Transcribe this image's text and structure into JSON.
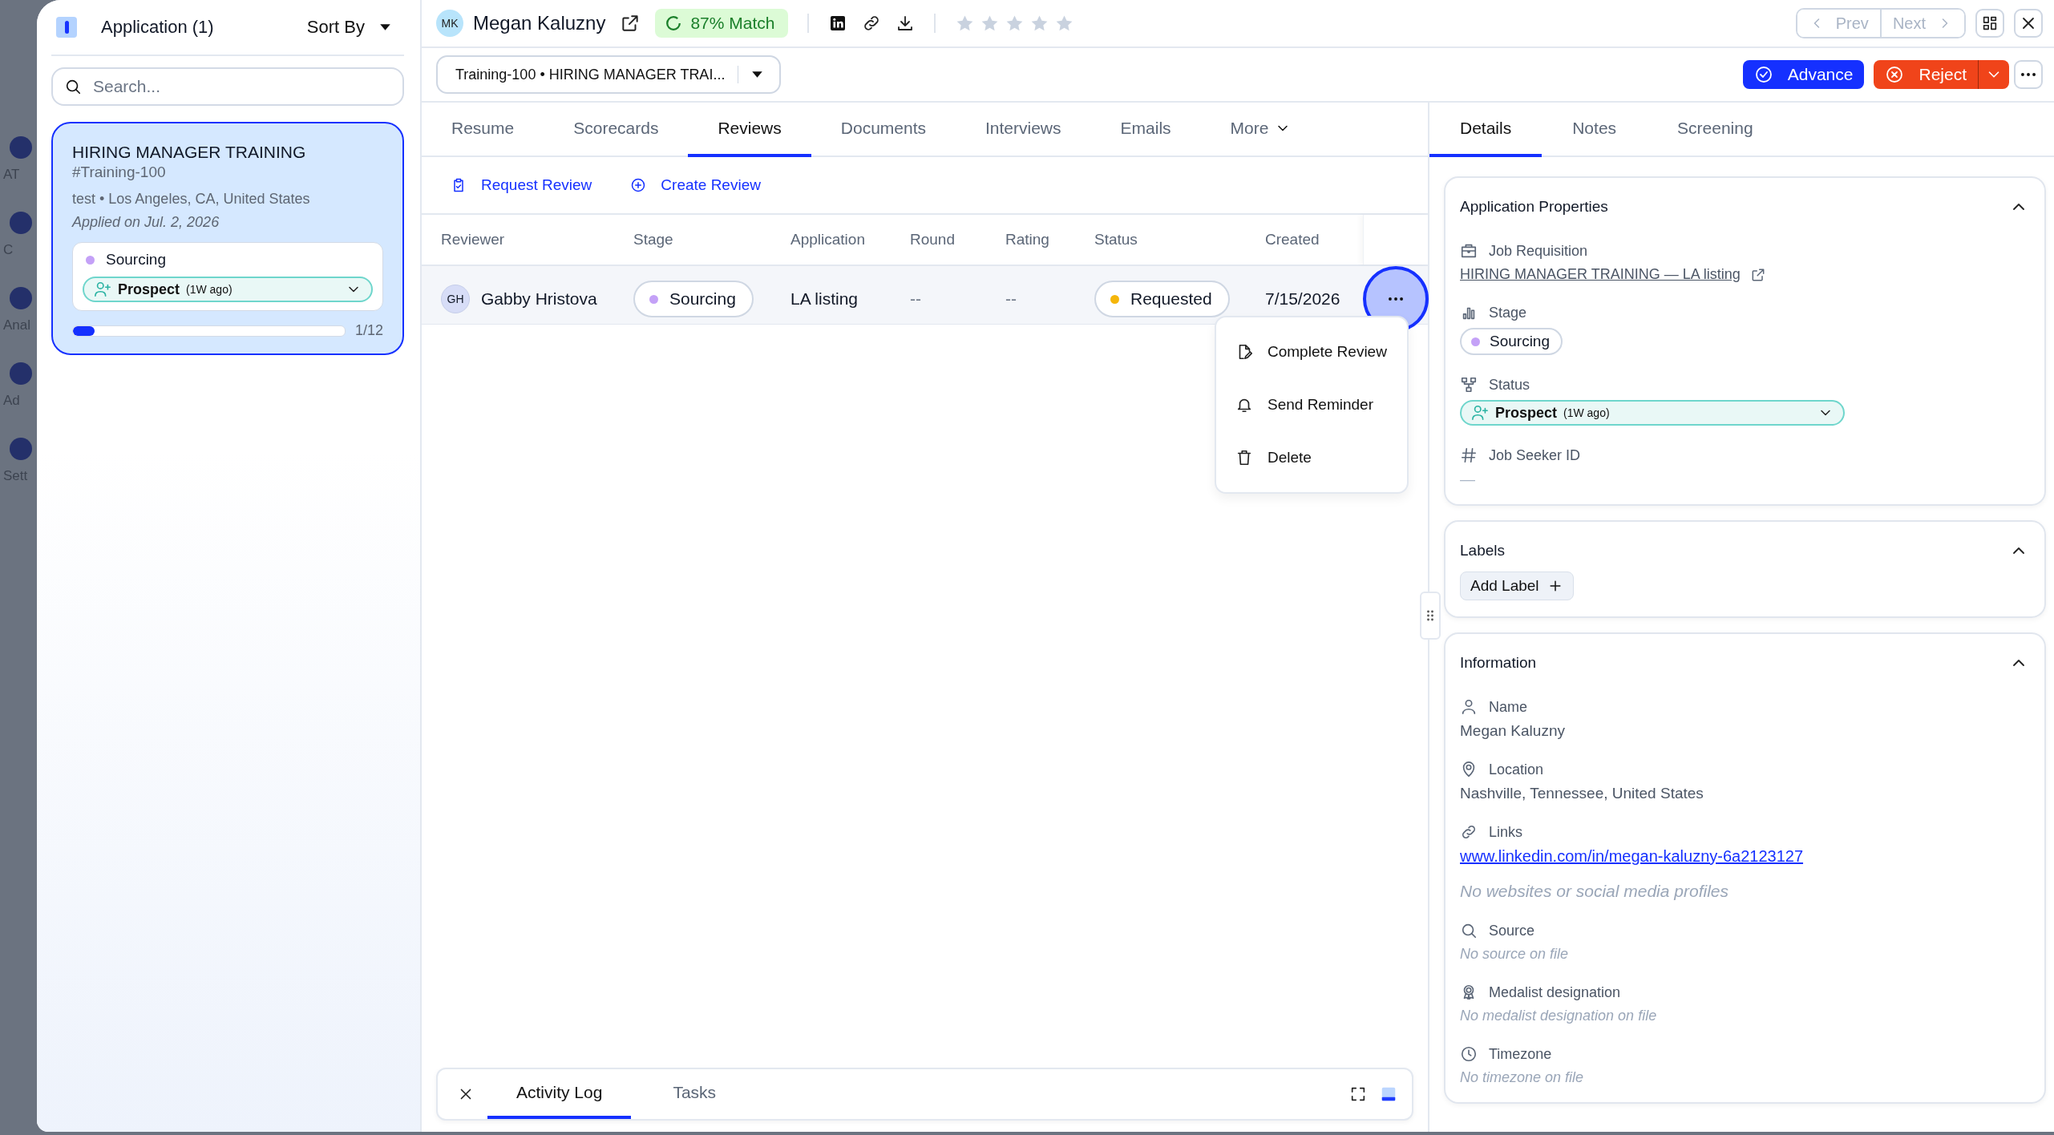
{
  "background_nav": {
    "labels": [
      "AT",
      "C",
      "Anal",
      "Ad",
      "Sett"
    ]
  },
  "list_panel": {
    "title": "Application (1)",
    "sort_label": "Sort By",
    "search": {
      "placeholder": "Search..."
    },
    "applications": [
      {
        "title": "HIRING MANAGER TRAINING",
        "code": "#Training-100",
        "meta": "test • Los Angeles, CA, United States",
        "applied": "Applied on Jul. 2, 2026",
        "stage": {
          "label": "Sourcing",
          "color": "#c4a1f7"
        },
        "status": {
          "label": "Prospect",
          "age": "(1W ago)"
        },
        "progress": {
          "level": 0.08,
          "text": "1/12"
        },
        "selected": true
      }
    ]
  },
  "candidate": {
    "initials": "MK",
    "name": "Megan Kaluzny",
    "match": "87% Match",
    "stars": 0
  },
  "pager": {
    "prev": {
      "label": "Prev",
      "disabled": true
    },
    "next": {
      "label": "Next",
      "disabled": true
    }
  },
  "application_select": {
    "value": "Training-100 • HIRING MANAGER TRAI..."
  },
  "actions": {
    "advance": "Advance",
    "reject": "Reject"
  },
  "middle_tabs": [
    {
      "label": "Resume",
      "selected": false,
      "kind": "tab"
    },
    {
      "label": "Scorecards",
      "selected": false,
      "kind": "tab"
    },
    {
      "label": "Reviews",
      "selected": true,
      "kind": "tab"
    },
    {
      "label": "Documents",
      "selected": false,
      "kind": "tab"
    },
    {
      "label": "Interviews",
      "selected": false,
      "kind": "tab"
    },
    {
      "label": "Emails",
      "selected": false,
      "kind": "tab"
    },
    {
      "label": "More",
      "selected": false,
      "kind": "menu"
    }
  ],
  "review_actions": [
    {
      "label": "Request Review",
      "kind": "request"
    },
    {
      "label": "Create Review",
      "kind": "create"
    }
  ],
  "table": {
    "columns": [
      "Reviewer",
      "Stage",
      "Application",
      "Round",
      "Rating",
      "Status",
      "Created"
    ],
    "rows": [
      {
        "initials": "GH",
        "reviewer": "Gabby Hristova",
        "stage": {
          "label": "Sourcing",
          "color": "#c4a1f7"
        },
        "application": "LA listing",
        "round": "--",
        "rating": "--",
        "status": {
          "label": "Requested",
          "color": "#f5b60a"
        },
        "created": "7/15/2026"
      }
    ]
  },
  "row_menu": {
    "items": [
      {
        "label": "Complete Review",
        "kind": "complete"
      },
      {
        "label": "Send Reminder",
        "kind": "remind"
      },
      {
        "label": "Delete",
        "kind": "delete"
      }
    ]
  },
  "bottom_panel": {
    "tabs": [
      {
        "label": "Activity Log",
        "selected": true
      },
      {
        "label": "Tasks",
        "selected": false
      }
    ]
  },
  "right_tabs": [
    {
      "label": "Details",
      "selected": true
    },
    {
      "label": "Notes",
      "selected": false
    },
    {
      "label": "Screening",
      "selected": false
    }
  ],
  "cards": [
    {
      "title": "Application Properties",
      "expanded": true,
      "fields": [
        {
          "kind": "requisition",
          "label": "Job Requisition",
          "link": "HIRING MANAGER TRAINING — LA listing"
        },
        {
          "kind": "stage",
          "label": "Stage",
          "pill": {
            "label": "Sourcing",
            "color": "#c4a1f7"
          }
        },
        {
          "kind": "status",
          "label": "Status",
          "status": {
            "label": "Prospect",
            "age": "(1W ago)"
          }
        },
        {
          "kind": "id",
          "label": "Job Seeker ID",
          "value": "—"
        }
      ]
    },
    {
      "title": "Labels",
      "expanded": true,
      "add_label": "Add Label"
    },
    {
      "title": "Information",
      "expanded": true,
      "fields": [
        {
          "kind": "name",
          "label": "Name",
          "value": "Megan Kaluzny"
        },
        {
          "kind": "location",
          "label": "Location",
          "value": "Nashville, Tennessee, United States"
        },
        {
          "kind": "links",
          "label": "Links",
          "url": "www.linkedin.com/in/megan-kaluzny-6a2123127",
          "note": "No websites or social media profiles"
        },
        {
          "kind": "source",
          "label": "Source",
          "note": "No source on file"
        },
        {
          "kind": "medal",
          "label": "Medalist designation",
          "note": "No medalist designation on file"
        },
        {
          "kind": "timezone",
          "label": "Timezone",
          "note": "No timezone on file"
        }
      ]
    }
  ]
}
